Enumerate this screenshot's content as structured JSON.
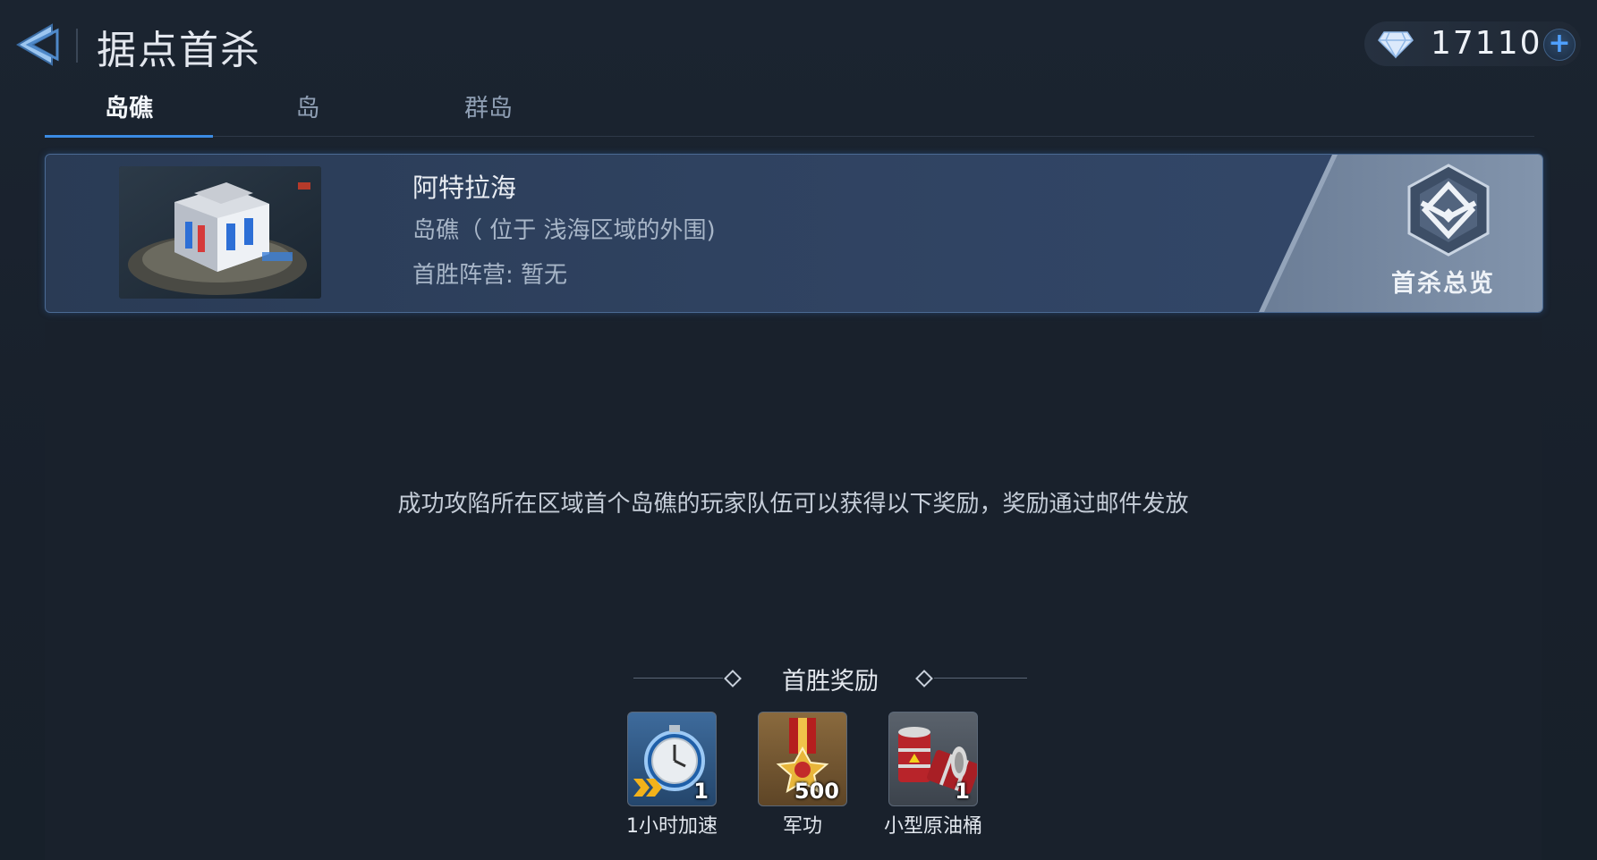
{
  "header": {
    "title": "据点首杀"
  },
  "currency": {
    "amount": "17110",
    "icon": "diamond-icon",
    "plus": "+"
  },
  "tabs": [
    {
      "label": "岛礁",
      "active": true
    },
    {
      "label": "岛",
      "active": false
    },
    {
      "label": "群岛",
      "active": false
    }
  ],
  "stronghold": {
    "name": "阿特拉海",
    "subtitle": "岛礁（ 位于 浅海区域的外围)",
    "status": "首胜阵营: 暂无",
    "overview_label": "首杀总览"
  },
  "description": "成功攻陷所在区域首个岛礁的玩家队伍可以获得以下奖励，奖励通过邮件发放",
  "rewards": {
    "title": "首胜奖励",
    "items": [
      {
        "label": "1小时加速",
        "qty": "1",
        "icon": "stopwatch-speedup-icon"
      },
      {
        "label": "军功",
        "qty": "500",
        "icon": "medal-icon"
      },
      {
        "label": "小型原油桶",
        "qty": "1",
        "icon": "oil-barrel-icon"
      }
    ]
  },
  "colors": {
    "accent": "#3b8be4",
    "background": "#19212c",
    "card": "#2f4260"
  }
}
